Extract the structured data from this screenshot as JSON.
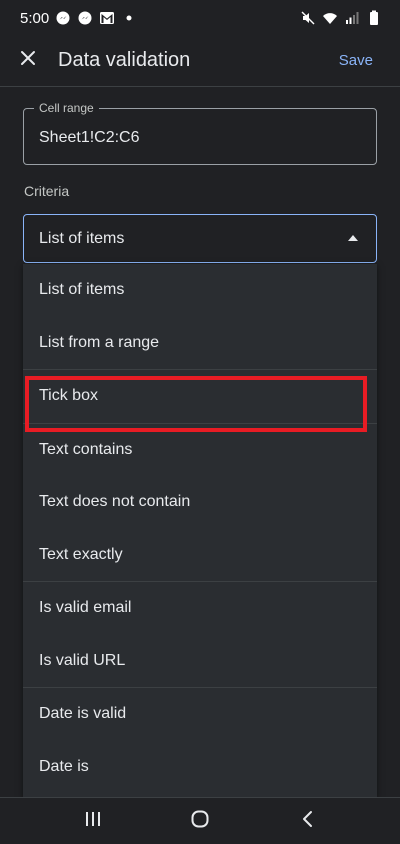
{
  "status_bar": {
    "time": "5:00",
    "left_icons": [
      "messenger-icon",
      "messenger-icon",
      "gmail-icon",
      "dot-icon"
    ],
    "right_icons": [
      "mute-icon",
      "wifi-icon",
      "signal-icon",
      "battery-icon"
    ]
  },
  "app_bar": {
    "title": "Data validation",
    "save_label": "Save",
    "close_icon": "close-icon"
  },
  "form": {
    "cell_range_label": "Cell range",
    "cell_range_value": "Sheet1!C2:C6",
    "criteria_label": "Criteria",
    "criteria_selected": "List of items"
  },
  "dropdown": {
    "groups": [
      [
        "List of items",
        "List from a range"
      ],
      [
        "Tick box"
      ],
      [
        "Text contains",
        "Text does not contain",
        "Text exactly"
      ],
      [
        "Is valid email",
        "Is valid URL"
      ],
      [
        "Date is valid",
        "Date is"
      ]
    ],
    "highlighted": "Tick box"
  },
  "colors": {
    "background": "#202124",
    "accent": "#8ab4f8",
    "highlight": "#e81c24",
    "menu_bg": "#2a2d31"
  },
  "nav_bar": {
    "buttons": [
      "recent-apps-icon",
      "home-icon",
      "back-icon"
    ]
  }
}
